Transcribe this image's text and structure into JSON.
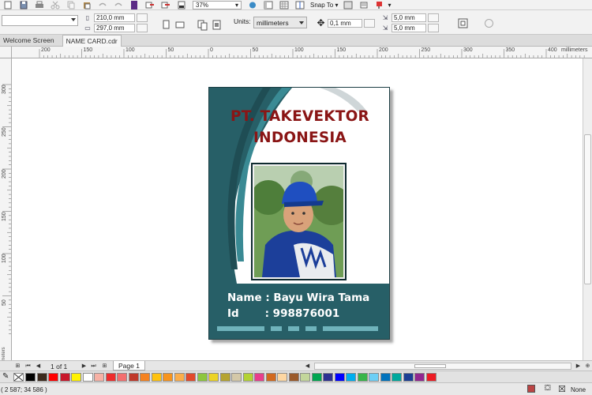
{
  "toolbar": {
    "zoom_value": "37%",
    "snap_label": "Snap To"
  },
  "property_bar": {
    "width_value": "210,0 mm",
    "height_value": "297,0 mm",
    "units_label": "Units:",
    "units_value": "millimeters",
    "nudge_value": "0,1 mm",
    "duplicate_x": "5,0 mm",
    "duplicate_y": "5,0 mm"
  },
  "doc_tabs": [
    {
      "label": "Welcome Screen",
      "active": false
    },
    {
      "label": "NAME CARD.cdr",
      "active": true
    }
  ],
  "ruler": {
    "h_labels": [
      "200",
      "150",
      "100",
      "50",
      "0",
      "50",
      "100",
      "150",
      "200",
      "250",
      "300",
      "350",
      "400"
    ],
    "h_units": "millimeters",
    "v_labels": [
      "300",
      "250",
      "200",
      "150",
      "100",
      "50"
    ],
    "v_units": "millimeters"
  },
  "card": {
    "title_line1": "PT. TAKEVEKTOR",
    "title_line2": "INDONESIA",
    "name_line": "Name : Bayu Wira Tama",
    "id_line": "Id       : 998876001",
    "colors": {
      "background": "#275f67",
      "title": "#8a1515",
      "white_panel": "#ffffff",
      "text": "#ffffff"
    }
  },
  "page_nav": {
    "page_count": "1 of 1",
    "page_tab": "Page 1"
  },
  "palette": {
    "colors": [
      "#000000",
      "#3c2a1d",
      "#ff0000",
      "#c8172b",
      "#fff200",
      "#ffffff",
      "#f7b1a5",
      "#ee2d2d",
      "#f36f6f",
      "#c0392b",
      "#f58220",
      "#ffc20e",
      "#f7941d",
      "#fbad4a",
      "#e2492b",
      "#8dc63f",
      "#ecd324",
      "#b5a32f",
      "#d4c8a8",
      "#b3d235",
      "#e83e8c",
      "#d2691e",
      "#fdd7a3",
      "#9b5a2b",
      "#c3d69b",
      "#00a651",
      "#2e3192",
      "#0000ff",
      "#00aeef",
      "#39b54a",
      "#6dcff6",
      "#0072bc",
      "#00a99d",
      "#1c3f94",
      "#92278f",
      "#ed1c24"
    ]
  },
  "status": {
    "coords": "( 2 587; 34 586 )",
    "fill_label": "None"
  }
}
